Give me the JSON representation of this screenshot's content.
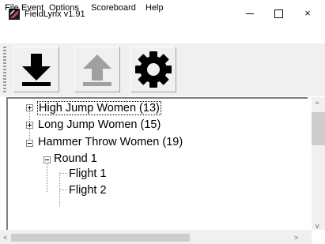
{
  "window": {
    "title": "FieldLynx  v1.91",
    "icon": "fieldlynx-logo",
    "controls": {
      "minimize": "–",
      "maximize": "□",
      "close": "×"
    }
  },
  "menu": {
    "items": [
      {
        "label": "File"
      },
      {
        "label": "Event"
      },
      {
        "label": "Options"
      },
      {
        "label": "Scoreboard"
      },
      {
        "label": "Help"
      }
    ]
  },
  "toolbar": {
    "buttons": [
      {
        "icon": "download-arrow-icon",
        "enabled": true
      },
      {
        "icon": "upload-arrow-icon",
        "enabled": false
      },
      {
        "icon": "gear-icon",
        "enabled": true
      }
    ]
  },
  "tree": {
    "events": [
      {
        "label": "High Jump Women  (13)",
        "expanded": false,
        "selected": true
      },
      {
        "label": "Long Jump Women  (15)",
        "expanded": false
      },
      {
        "label": "Hammer Throw Women  (19)",
        "expanded": true,
        "children": [
          {
            "label": "Round 1",
            "expanded": true,
            "children": [
              {
                "label": "Flight 1"
              },
              {
                "label": "Flight 2"
              }
            ]
          }
        ]
      }
    ]
  },
  "scrollbars": {
    "vertical": {
      "up": "^",
      "down": "v"
    },
    "horizontal": {
      "left": "<",
      "right": ">"
    }
  },
  "colors": {
    "toolbar_bg": "#f0f0f0",
    "icon_black": "#000000",
    "icon_disabled": "#a0a0a0",
    "logo_pink": "#d6388a"
  }
}
